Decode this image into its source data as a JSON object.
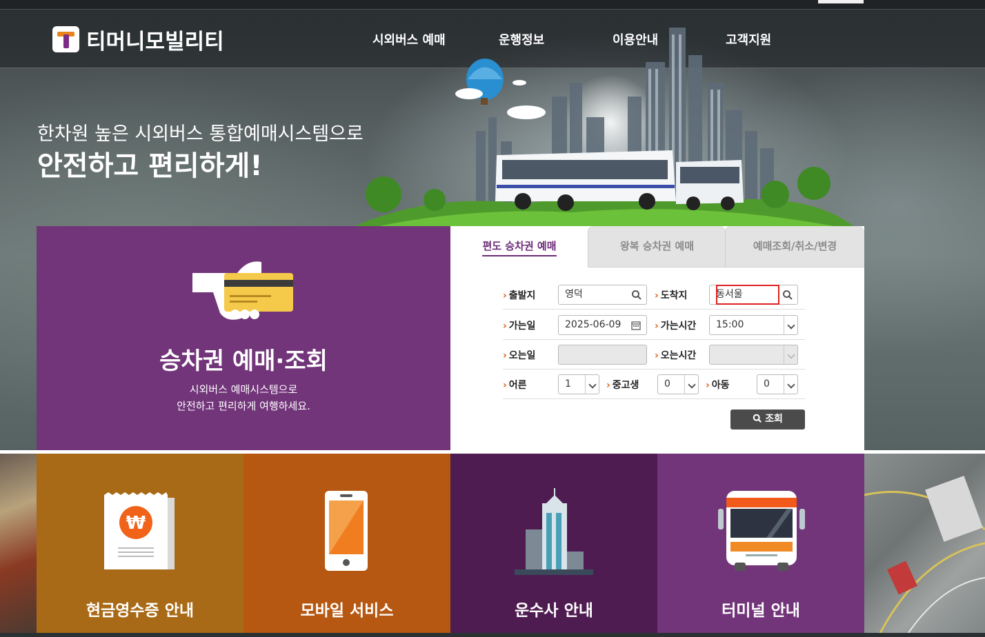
{
  "header": {
    "logo_text": "티머니모빌리티",
    "nav": [
      "시외버스 예매",
      "운행정보",
      "이용안내",
      "고객지원"
    ]
  },
  "hero": {
    "line1": "한차원 높은 시외버스 통합예매시스템으로",
    "line2": "안전하고 편리하게!"
  },
  "promo": {
    "title": "승차권 예매·조회",
    "sub1": "시외버스 예매시스템으로",
    "sub2": "안전하고 편리하게 여행하세요."
  },
  "booking": {
    "tabs": [
      "편도 승차권 예매",
      "왕복 승차권 예매",
      "예매조회/취소/변경"
    ],
    "labels": {
      "depart": "출발지",
      "arrive": "도착지",
      "go_date": "가는일",
      "go_time": "가는시간",
      "return_date": "오는일",
      "return_time": "오는시간",
      "adult": "어른",
      "youth": "중고생",
      "child": "아동"
    },
    "values": {
      "depart": "영덕",
      "arrive": "동서울",
      "go_date": "2025-06-09",
      "go_time": "15:00",
      "return_date": "",
      "return_time": "",
      "adult": "1",
      "youth": "0",
      "child": "0"
    },
    "search_label": "조회"
  },
  "tiles": [
    {
      "label": "현금영수증 안내",
      "color": "#a86a16"
    },
    {
      "label": "모바일 서비스",
      "color": "#b65812"
    },
    {
      "label": "운수사 안내",
      "color": "#4f1c52"
    },
    {
      "label": "터미널 안내",
      "color": "#72357a"
    }
  ]
}
